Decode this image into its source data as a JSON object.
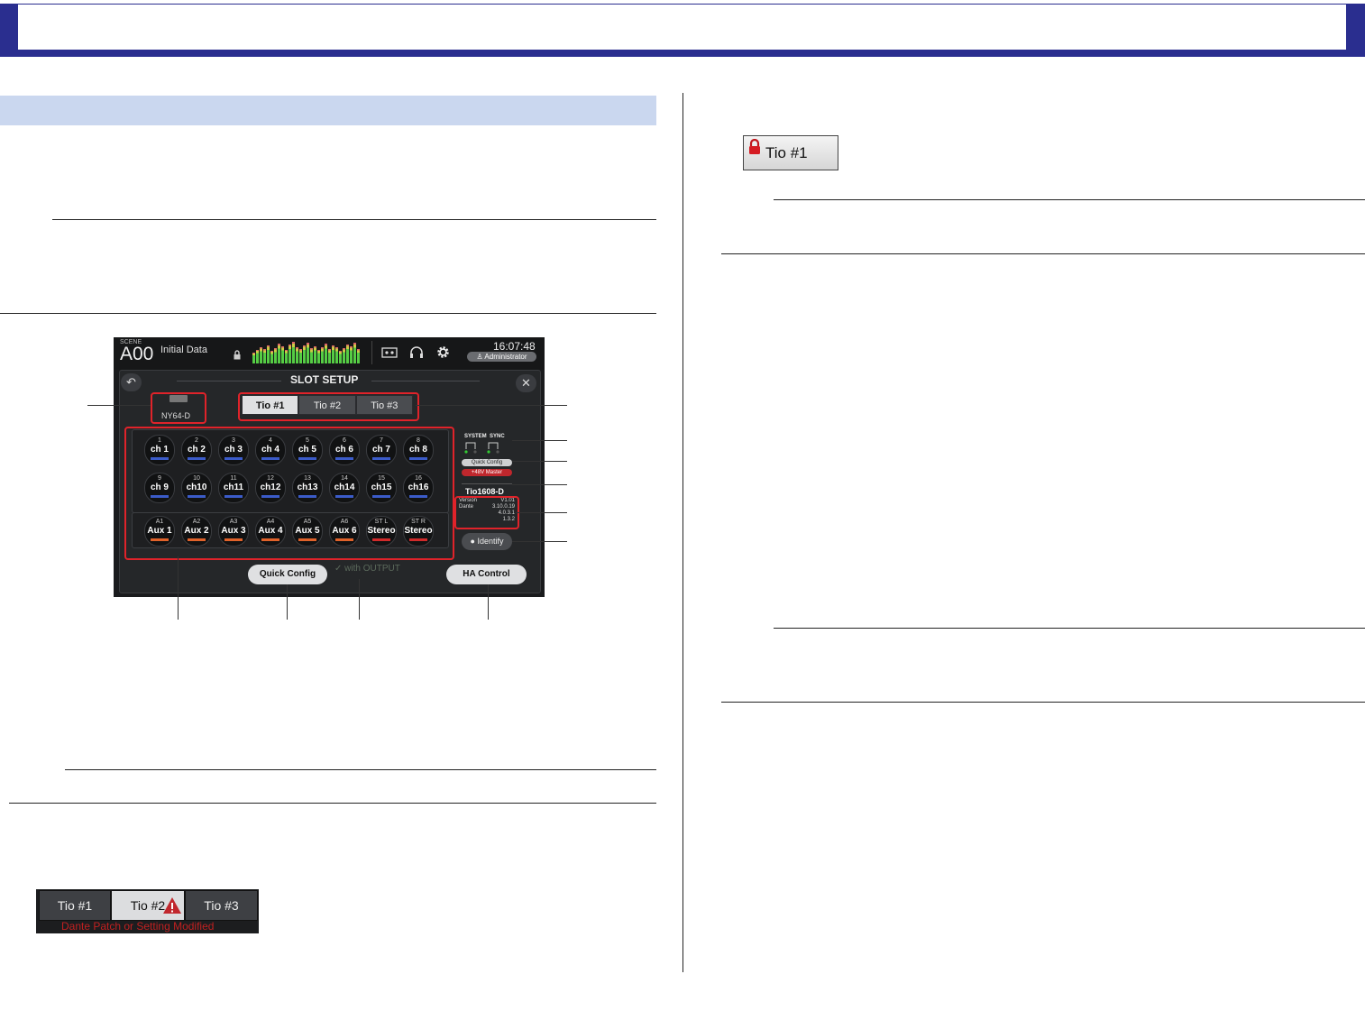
{
  "screen": {
    "scene_label": "SCENE",
    "scene_number": "A00",
    "scene_name": "Initial Data",
    "time": "16:07:48",
    "user": "Administrator",
    "dialog_title": "SLOT SETUP",
    "card_name": "NY64-D",
    "tabs": [
      "Tio #1",
      "Tio #2",
      "Tio #3"
    ],
    "selected_tab": "Tio #1",
    "channels": [
      {
        "num": "1",
        "name": "ch 1"
      },
      {
        "num": "2",
        "name": "ch 2"
      },
      {
        "num": "3",
        "name": "ch 3"
      },
      {
        "num": "4",
        "name": "ch 4"
      },
      {
        "num": "5",
        "name": "ch 5"
      },
      {
        "num": "6",
        "name": "ch 6"
      },
      {
        "num": "7",
        "name": "ch 7"
      },
      {
        "num": "8",
        "name": "ch 8"
      },
      {
        "num": "9",
        "name": "ch 9"
      },
      {
        "num": "10",
        "name": "ch10"
      },
      {
        "num": "11",
        "name": "ch11"
      },
      {
        "num": "12",
        "name": "ch12"
      },
      {
        "num": "13",
        "name": "ch13"
      },
      {
        "num": "14",
        "name": "ch14"
      },
      {
        "num": "15",
        "name": "ch15"
      },
      {
        "num": "16",
        "name": "ch16"
      }
    ],
    "outputs": [
      {
        "num": "A1",
        "name": "Aux 1"
      },
      {
        "num": "A2",
        "name": "Aux 2"
      },
      {
        "num": "A3",
        "name": "Aux 3"
      },
      {
        "num": "A4",
        "name": "Aux 4"
      },
      {
        "num": "A5",
        "name": "Aux 5"
      },
      {
        "num": "A6",
        "name": "Aux 6"
      },
      {
        "num": "ST L",
        "name": "Stereo"
      },
      {
        "num": "ST R",
        "name": "Stereo"
      }
    ],
    "status": {
      "system": "SYSTEM",
      "sync": "SYNC"
    },
    "quick_config_indicator": "Quick Config",
    "phantom_master": "+48V Master",
    "model": "Tio1608-D",
    "version_info": {
      "version_label": "Version",
      "version": "V1.01",
      "dante_label": "Dante",
      "dante_1": "3.10.0.19",
      "dante_2": "4.0.3.1",
      "dante_3": "1.3.2"
    },
    "identify_button": "Identify",
    "quick_config_button": "Quick Config",
    "with_output": "with OUTPUT",
    "ha_control_button": "HA Control",
    "colors": {
      "channel_underline": "#3b5bc9",
      "aux_underline": "#e0622a",
      "stereo_underline": "#d02a2a",
      "callout": "#e0232a"
    }
  },
  "modified_strip": {
    "tabs": [
      "Tio #1",
      "Tio #2",
      "Tio #3"
    ],
    "selected_tab": "Tio #2",
    "warning": "Dante Patch or Setting Modified"
  },
  "locked_tab": {
    "label": "Tio #1"
  },
  "icons": [
    "lock-icon",
    "back-icon",
    "close-icon",
    "headphones-icon",
    "gear-icon",
    "recorder-icon",
    "user-icon",
    "warning-icon"
  ]
}
